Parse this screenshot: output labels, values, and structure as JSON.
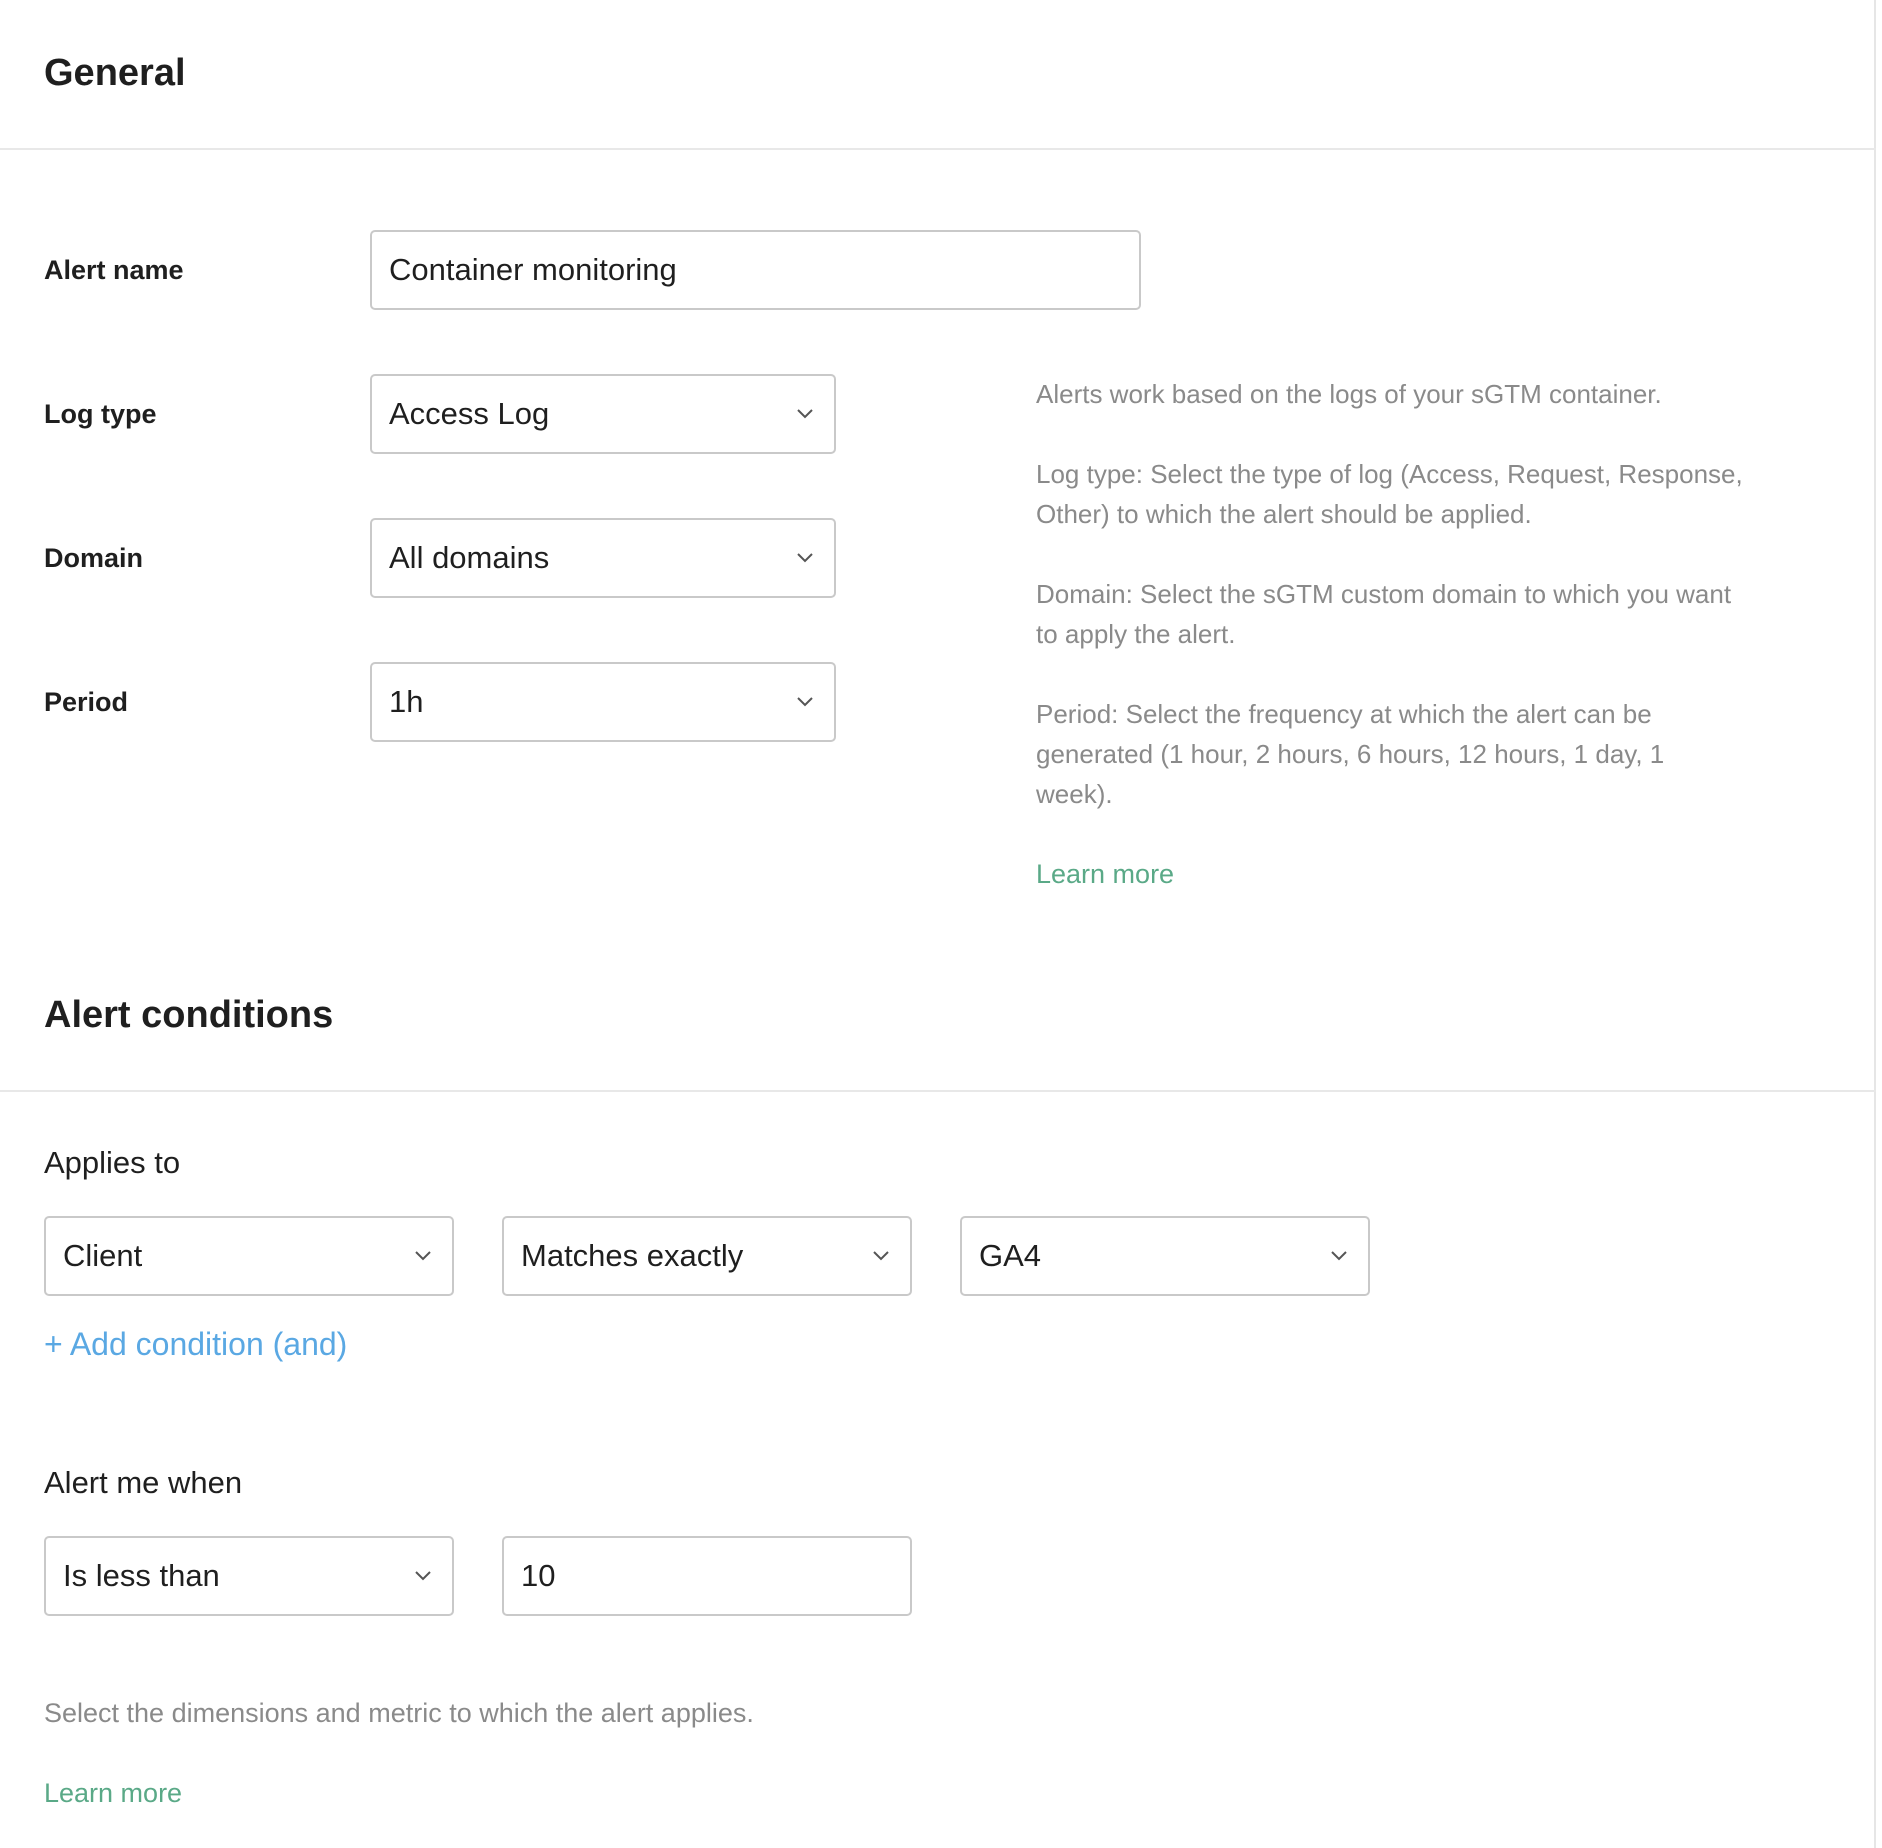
{
  "general": {
    "title": "General",
    "alert_name_label": "Alert name",
    "alert_name_value": "Container monitoring",
    "log_type_label": "Log type",
    "log_type_value": "Access Log",
    "domain_label": "Domain",
    "domain_value": "All domains",
    "period_label": "Period",
    "period_value": "1h",
    "help": {
      "p1": "Alerts work based on the logs of your sGTM container.",
      "p2": "Log type: Select the type of log (Access, Request, Response, Other) to which the alert should be applied.",
      "p3": "Domain: Select the sGTM custom domain to which you want to apply the alert.",
      "p4": "Period: Select the frequency at which the alert can be generated (1 hour, 2 hours, 6 hours, 12 hours, 1 day, 1 week).",
      "learn_more": "Learn more"
    }
  },
  "conditions": {
    "title": "Alert conditions",
    "applies_to_label": "Applies to",
    "dimension_value": "Client",
    "operator_value": "Matches exactly",
    "match_value": "GA4",
    "add_condition": "+ Add condition (and)",
    "alert_me_when_label": "Alert me when",
    "comparison_value": "Is less than",
    "threshold_value": "10",
    "note": "Select the dimensions and metric to which the alert applies.",
    "learn_more": "Learn more"
  },
  "colors": {
    "link_green": "#5aa987",
    "link_blue": "#5aa8e3",
    "help_text": "#8a8a8a",
    "border": "#c9c9c9"
  },
  "icons": {
    "dropdown": "chevron-down-icon"
  }
}
